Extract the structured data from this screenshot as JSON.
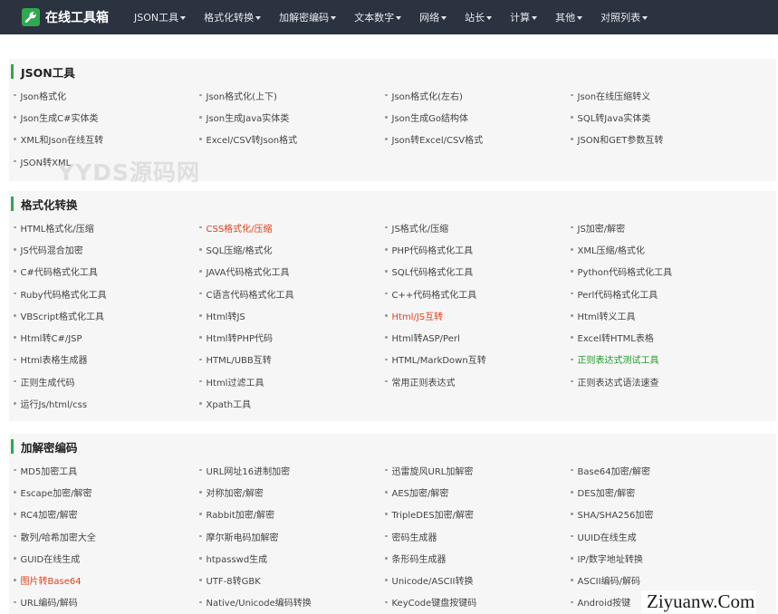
{
  "header": {
    "brand": "在线工具箱",
    "nav": [
      {
        "label": "JSON工具"
      },
      {
        "label": "格式化转换"
      },
      {
        "label": "加解密编码"
      },
      {
        "label": "文本数字"
      },
      {
        "label": "网络"
      },
      {
        "label": "站长"
      },
      {
        "label": "计算"
      },
      {
        "label": "其他"
      },
      {
        "label": "对照列表"
      }
    ]
  },
  "sections": [
    {
      "title": "JSON工具",
      "items": [
        {
          "label": "Json格式化"
        },
        {
          "label": "Json格式化(上下)"
        },
        {
          "label": "Json格式化(左右)"
        },
        {
          "label": "Json在线压缩转义"
        },
        {
          "label": "Json生成C#实体类"
        },
        {
          "label": "Json生成Java实体类"
        },
        {
          "label": "Json生成Go结构体"
        },
        {
          "label": "SQL转Java实体类"
        },
        {
          "label": "XML和Json在线互转"
        },
        {
          "label": "Excel/CSV转Json格式"
        },
        {
          "label": "Json转Excel/CSV格式"
        },
        {
          "label": "JSON和GET参数互转"
        },
        {
          "label": "JSON转XML"
        }
      ]
    },
    {
      "title": "格式化转换",
      "items": [
        {
          "label": "HTML格式化/压缩"
        },
        {
          "label": "CSS格式化/压缩",
          "color": "#e2401c"
        },
        {
          "label": "JS格式化/压缩"
        },
        {
          "label": "JS加密/解密"
        },
        {
          "label": "JS代码混合加密"
        },
        {
          "label": "SQL压缩/格式化"
        },
        {
          "label": "PHP代码格式化工具"
        },
        {
          "label": "XML压缩/格式化"
        },
        {
          "label": "C#代码格式化工具"
        },
        {
          "label": "JAVA代码格式化工具"
        },
        {
          "label": "SQL代码格式化工具"
        },
        {
          "label": "Python代码格式化工具"
        },
        {
          "label": "Ruby代码格式化工具"
        },
        {
          "label": "C语言代码格式化工具"
        },
        {
          "label": "C++代码格式化工具"
        },
        {
          "label": "Perl代码格式化工具"
        },
        {
          "label": "VBScript格式化工具"
        },
        {
          "label": "Html转JS"
        },
        {
          "label": "Html/JS互转",
          "color": "#e2401c"
        },
        {
          "label": "Html转义工具"
        },
        {
          "label": "Html转C#/JSP"
        },
        {
          "label": "Html转PHP代码"
        },
        {
          "label": "Html转ASP/Perl"
        },
        {
          "label": "Excel转HTML表格"
        },
        {
          "label": "Html表格生成器"
        },
        {
          "label": "HTML/UBB互转"
        },
        {
          "label": "HTML/MarkDown互转"
        },
        {
          "label": "正则表达式测试工具",
          "color": "#1f9a2b"
        },
        {
          "label": "正则生成代码"
        },
        {
          "label": "Html过滤工具"
        },
        {
          "label": "常用正则表达式"
        },
        {
          "label": "正则表达式语法速查"
        },
        {
          "label": "运行Js/html/css"
        },
        {
          "label": "Xpath工具"
        }
      ]
    },
    {
      "title": "加解密编码",
      "items": [
        {
          "label": "MD5加密工具"
        },
        {
          "label": "URL网址16进制加密"
        },
        {
          "label": "迅雷旋风URL加解密"
        },
        {
          "label": "Base64加密/解密"
        },
        {
          "label": "Escape加密/解密"
        },
        {
          "label": "对称加密/解密"
        },
        {
          "label": "AES加密/解密"
        },
        {
          "label": "DES加密/解密"
        },
        {
          "label": "RC4加密/解密"
        },
        {
          "label": "Rabbit加密/解密"
        },
        {
          "label": "TripleDES加密/解密"
        },
        {
          "label": "SHA/SHA256加密"
        },
        {
          "label": "散列/哈希加密大全"
        },
        {
          "label": "摩尔斯电码加解密"
        },
        {
          "label": "密码生成器"
        },
        {
          "label": "UUID在线生成"
        },
        {
          "label": "GUID在线生成"
        },
        {
          "label": "htpasswd生成"
        },
        {
          "label": "条形码生成器"
        },
        {
          "label": "IP/数字地址转换"
        },
        {
          "label": "图片转Base64",
          "color": "#e2401c"
        },
        {
          "label": "UTF-8转GBK"
        },
        {
          "label": "Unicode/ASCII转换"
        },
        {
          "label": "ASCII编码/解码"
        },
        {
          "label": "URL编码/解码"
        },
        {
          "label": "Native/Unicode编码转换"
        },
        {
          "label": "KeyCode键盘按键码"
        },
        {
          "label": "Android按键"
        }
      ]
    }
  ],
  "watermarks": {
    "top": "YYDS源码网",
    "bottom": "Ziyuanw.Com"
  }
}
